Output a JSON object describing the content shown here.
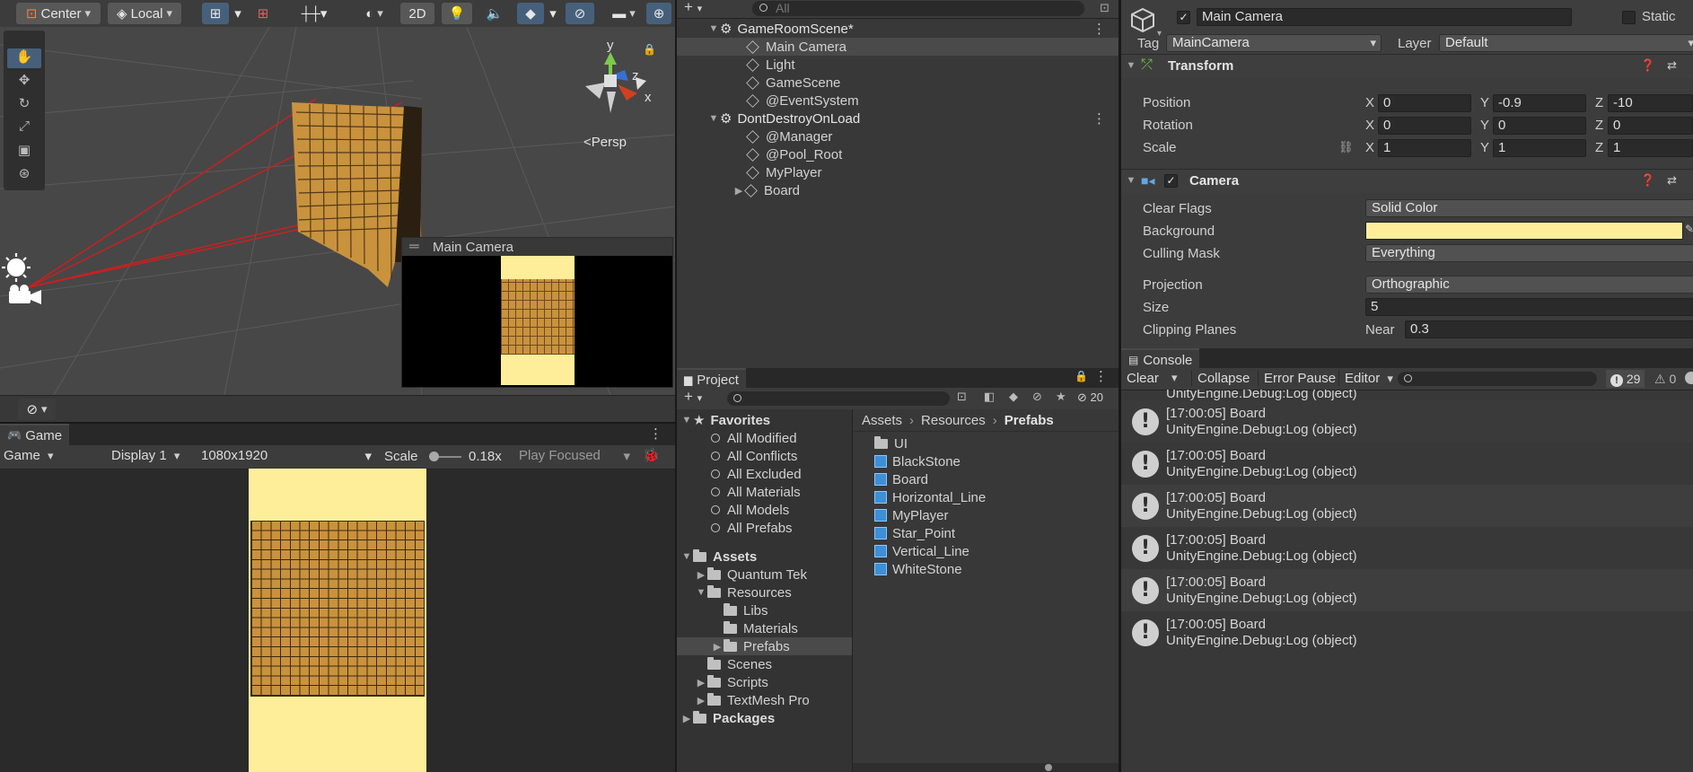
{
  "scene_toolbar": {
    "pivot": "Center",
    "space": "Local",
    "mode_2d": "2D",
    "persp": "<Persp",
    "gizmo_y": "y",
    "gizmo_z": "z",
    "gizmo_x": "x",
    "overlay_title": "Main Camera"
  },
  "game": {
    "tab": "Game",
    "view_select": "Game",
    "display": "Display 1",
    "resolution": "1080x1920",
    "scale_label": "Scale",
    "scale_value": "0.18x",
    "play_mode": "Play Focused"
  },
  "hierarchy": {
    "search_placeholder": "All",
    "items": [
      {
        "label": "GameRoomScene*",
        "kind": "scene"
      },
      {
        "label": "Main Camera",
        "kind": "object",
        "selected": true
      },
      {
        "label": "Light",
        "kind": "object"
      },
      {
        "label": "GameScene",
        "kind": "object"
      },
      {
        "label": "@EventSystem",
        "kind": "object"
      },
      {
        "label": "DontDestroyOnLoad",
        "kind": "scene"
      },
      {
        "label": "@Manager",
        "kind": "object"
      },
      {
        "label": "@Pool_Root",
        "kind": "object"
      },
      {
        "label": "MyPlayer",
        "kind": "object"
      },
      {
        "label": "Board",
        "kind": "object",
        "collapsed": true
      }
    ]
  },
  "project": {
    "tab": "Project",
    "hidden_count": "20",
    "favorites_label": "Favorites",
    "favorites": [
      "All Modified",
      "All Conflicts",
      "All Excluded",
      "All Materials",
      "All Models",
      "All Prefabs"
    ],
    "assets_label": "Assets",
    "tree": [
      {
        "label": "Quantum Tek",
        "depth": 1,
        "arrow": "▶"
      },
      {
        "label": "Resources",
        "depth": 1,
        "arrow": "▼"
      },
      {
        "label": "Libs",
        "depth": 2,
        "arrow": ""
      },
      {
        "label": "Materials",
        "depth": 2,
        "arrow": ""
      },
      {
        "label": "Prefabs",
        "depth": 2,
        "arrow": "▶",
        "selected": true
      },
      {
        "label": "Scenes",
        "depth": 1,
        "arrow": ""
      },
      {
        "label": "Scripts",
        "depth": 1,
        "arrow": "▶"
      },
      {
        "label": "TextMesh Pro",
        "depth": 1,
        "arrow": "▶"
      }
    ],
    "packages_label": "Packages",
    "breadcrumb": [
      "Assets",
      "Resources",
      "Prefabs"
    ],
    "contents": [
      {
        "label": "UI",
        "kind": "folder"
      },
      {
        "label": "BlackStone",
        "kind": "prefab"
      },
      {
        "label": "Board",
        "kind": "prefab"
      },
      {
        "label": "Horizontal_Line",
        "kind": "prefab"
      },
      {
        "label": "MyPlayer",
        "kind": "prefab"
      },
      {
        "label": "Star_Point",
        "kind": "prefab"
      },
      {
        "label": "Vertical_Line",
        "kind": "prefab"
      },
      {
        "label": "WhiteStone",
        "kind": "prefab"
      }
    ]
  },
  "inspector": {
    "object_name": "Main Camera",
    "static_label": "Static",
    "tag_label": "Tag",
    "tag_value": "MainCamera",
    "layer_label": "Layer",
    "layer_value": "Default",
    "transform": {
      "title": "Transform",
      "position_label": "Position",
      "rotation_label": "Rotation",
      "scale_label": "Scale",
      "position": [
        "0",
        "-0.9",
        "-10"
      ],
      "rotation": [
        "0",
        "0",
        "0"
      ],
      "scale": [
        "1",
        "1",
        "1"
      ],
      "x": "X",
      "y": "Y",
      "z": "Z"
    },
    "camera": {
      "title": "Camera",
      "clear_flags_label": "Clear Flags",
      "clear_flags": "Solid Color",
      "background_label": "Background",
      "background_color": "#FFEE99",
      "culling_mask_label": "Culling Mask",
      "culling_mask": "Everything",
      "projection_label": "Projection",
      "projection": "Orthographic",
      "size_label": "Size",
      "size": "5",
      "clipping_label": "Clipping Planes",
      "near_label": "Near",
      "near": "0.3"
    }
  },
  "console": {
    "tab": "Console",
    "clear": "Clear",
    "collapse": "Collapse",
    "error_pause": "Error Pause",
    "editor": "Editor",
    "log_count": "29",
    "warn_count": "0",
    "partial_line": "UnityEngine.Debug:Log (object)",
    "entries": [
      {
        "line1": "[17:00:05] Board",
        "line2": "UnityEngine.Debug:Log (object)"
      },
      {
        "line1": "[17:00:05] Board",
        "line2": "UnityEngine.Debug:Log (object)"
      },
      {
        "line1": "[17:00:05] Board",
        "line2": "UnityEngine.Debug:Log (object)"
      },
      {
        "line1": "[17:00:05] Board",
        "line2": "UnityEngine.Debug:Log (object)"
      },
      {
        "line1": "[17:00:05] Board",
        "line2": "UnityEngine.Debug:Log (object)"
      },
      {
        "line1": "[17:00:05] Board",
        "line2": "UnityEngine.Debug:Log (object)"
      }
    ]
  }
}
